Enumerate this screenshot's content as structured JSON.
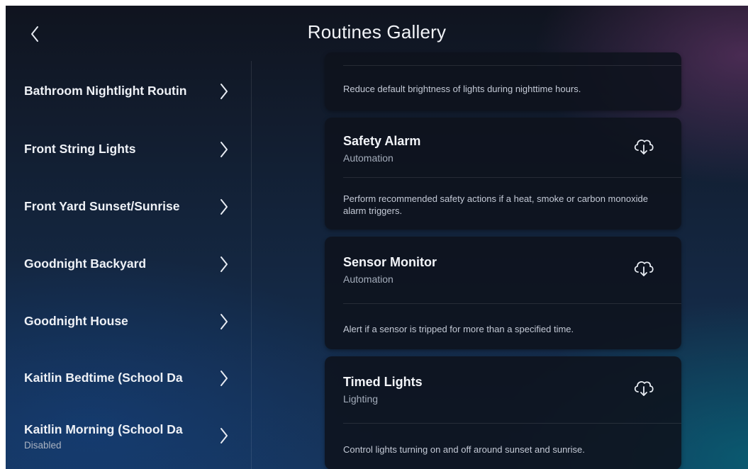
{
  "header": {
    "title": "Routines Gallery"
  },
  "sidebar": {
    "items": [
      {
        "label": "Bathroom Nightlight Routin",
        "sub": ""
      },
      {
        "label": "Front String Lights",
        "sub": ""
      },
      {
        "label": "Front Yard Sunset/Sunrise",
        "sub": ""
      },
      {
        "label": "Goodnight Backyard",
        "sub": ""
      },
      {
        "label": "Goodnight House",
        "sub": ""
      },
      {
        "label": "Kaitlin Bedtime (School Da",
        "sub": ""
      },
      {
        "label": "Kaitlin Morning (School Da",
        "sub": "Disabled"
      }
    ]
  },
  "gallery": {
    "cards": [
      {
        "title": "",
        "category": "",
        "description": "Reduce default brightness of lights during nighttime hours."
      },
      {
        "title": "Safety Alarm",
        "category": "Automation",
        "description": "Perform recommended safety actions if a heat, smoke or carbon monoxide alarm triggers."
      },
      {
        "title": "Sensor Monitor",
        "category": "Automation",
        "description": "Alert if a sensor is tripped for more than a specified time."
      },
      {
        "title": "Timed Lights",
        "category": "Lighting",
        "description": "Control lights turning on and off around sunset and sunrise."
      }
    ]
  },
  "icons": {
    "back": "chevron-left-icon",
    "list_arrow": "chevron-right-icon",
    "download": "cloud-download-icon"
  },
  "colors": {
    "background_top": "#10141f",
    "background_bottom": "#16345a",
    "card": "#0e121c",
    "text_primary": "#eef1f6",
    "text_secondary": "#a4adbb"
  }
}
